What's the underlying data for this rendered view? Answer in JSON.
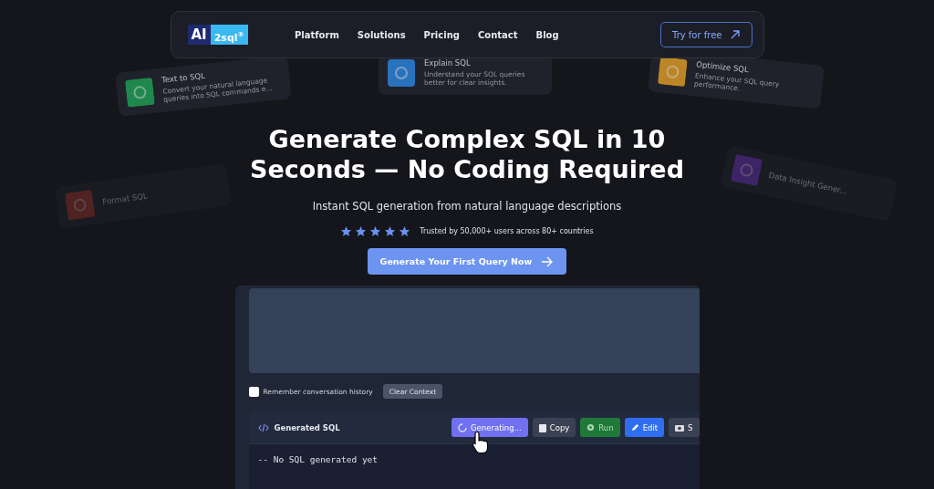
{
  "nav": {
    "logo_main": "AI",
    "logo_badge": "2sql",
    "logo_mark": "®",
    "links": [
      {
        "label": "Platform"
      },
      {
        "label": "Solutions"
      },
      {
        "label": "Pricing"
      },
      {
        "label": "Contact"
      },
      {
        "label": "Blog"
      }
    ],
    "cta": "Try for free"
  },
  "feature_cards": [
    {
      "kind": "text",
      "title": "Text to SQL",
      "description": "Convert your natural language queries into SQL commands e..."
    },
    {
      "kind": "explain",
      "title": "Explain SQL",
      "description": "Understand your SQL queries better for clear insights."
    },
    {
      "kind": "optimize",
      "title": "Optimize SQL",
      "description": "Enhance your SQL query performance."
    },
    {
      "kind": "format",
      "title": "Format SQL"
    },
    {
      "kind": "insight",
      "title": "Data Insight Gener..."
    }
  ],
  "hero": {
    "title_line1": "Generate Complex SQL in 10",
    "title_line2": "Seconds — No Coding Required",
    "subtitle": "Instant SQL generation from natural language descriptions",
    "stars": 5,
    "trust": "Trusted by 50,000+ users across 80+ countries",
    "cta": "Generate Your First Query Now"
  },
  "editor": {
    "remember_label": "Remember conversation history",
    "remember_checked": false,
    "clear_button": "Clear Context",
    "output_title": "Generated SQL",
    "actions": [
      {
        "kind": "generating",
        "label": "Generating..."
      },
      {
        "kind": "copy",
        "label": "Copy"
      },
      {
        "kind": "run",
        "label": "Run"
      },
      {
        "kind": "edit",
        "label": "Edit"
      },
      {
        "kind": "camera",
        "label": "S"
      }
    ],
    "code": "-- No SQL generated yet"
  }
}
